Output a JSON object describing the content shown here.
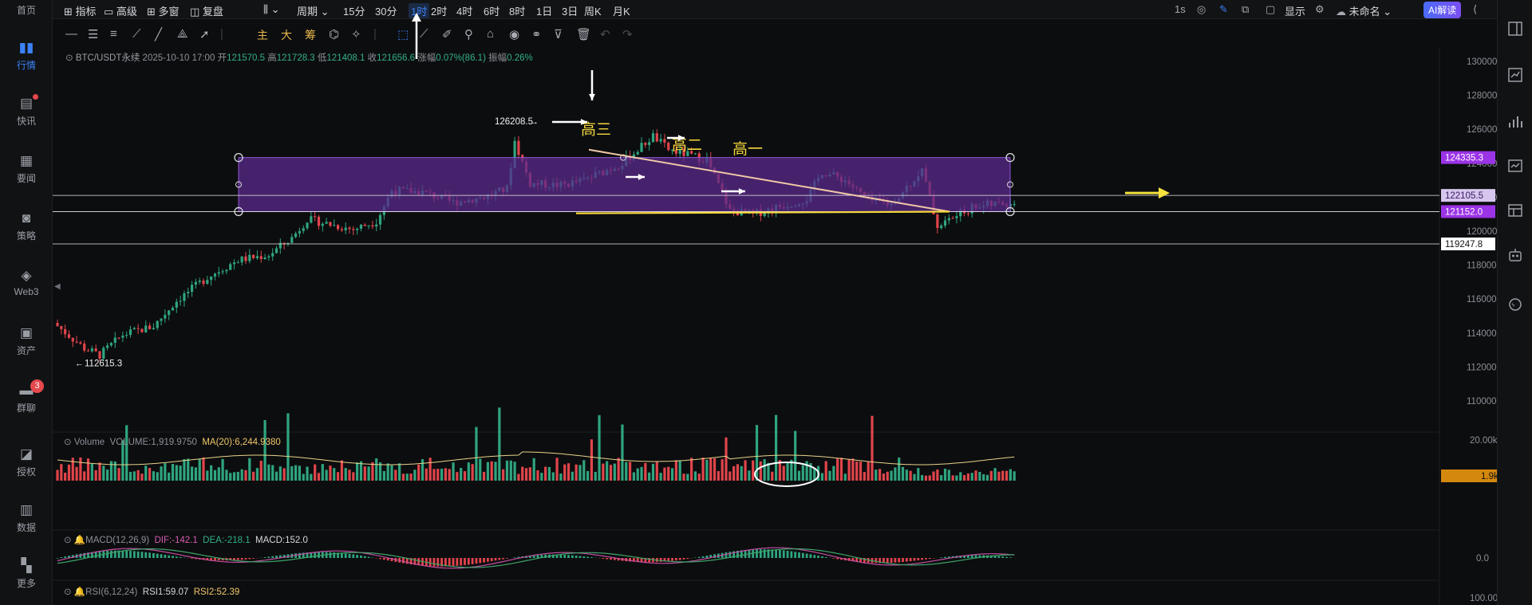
{
  "leftnav": [
    {
      "label": "首页",
      "icon": "home-icon"
    },
    {
      "label": "行情",
      "icon": "chart-bars-icon",
      "active": true
    },
    {
      "label": "快讯",
      "icon": "news-icon",
      "dot": true
    },
    {
      "label": "要闻",
      "icon": "document-icon"
    },
    {
      "label": "策略",
      "icon": "robot-icon"
    },
    {
      "label": "Web3",
      "icon": "web3-icon"
    },
    {
      "label": "资产",
      "icon": "wallet-icon"
    },
    {
      "label": "群聊",
      "icon": "chat-icon",
      "badge": "3"
    },
    {
      "label": "授权",
      "icon": "key-icon"
    },
    {
      "label": "数据",
      "icon": "data-icon"
    },
    {
      "label": "更多",
      "icon": "grid-icon"
    }
  ],
  "topbar": {
    "indicator": "指标",
    "advanced": "高级",
    "multi_window": "多窗",
    "replay": "复盘",
    "period": "周期",
    "intervals": [
      "15分",
      "30分",
      "1时",
      "2时",
      "4时",
      "6时",
      "8时",
      "1日",
      "3日",
      "周K",
      "月K"
    ],
    "active_interval": "1时",
    "refresh": "1s",
    "display": "显示",
    "layout_name": "未命名",
    "ai_button": "AI解读"
  },
  "drawbar": {
    "main": "主",
    "big": "大",
    "chips": "筹"
  },
  "info": {
    "symbol": "BTC/USDT永续",
    "datetime": "2025-10-10 17:00",
    "open_label": "开",
    "open": "121570.5",
    "high_label": "高",
    "high": "121728.3",
    "low_label": "低",
    "low": "121408.1",
    "close_label": "收",
    "close": "121656.6",
    "change_label": "涨幅",
    "change": "0.07%(86.1)",
    "amp_label": "振幅",
    "amp": "0.26%"
  },
  "price_axis": [
    "130000.0",
    "128000.0",
    "126000.0",
    "124000.0",
    "122000.0",
    "120000.0",
    "118000.0",
    "116000.0",
    "114000.0",
    "112000.0",
    "110000.0"
  ],
  "price_tags": {
    "top": "124335.3",
    "current": "122105.5",
    "bottom": "121152.0",
    "support": "119247.8"
  },
  "annotations": {
    "high_price": "126208.5",
    "low_price": "112615.3",
    "gao_san": "高三",
    "gao_er": "高二",
    "gao_yi": "高一"
  },
  "volume": {
    "title": "Volume",
    "volume_label": "VOLUME:1,919.9750",
    "ma_label": "MA(20):6,244.9380",
    "axis": "20.00k",
    "tag": "1.9k"
  },
  "macd": {
    "title": "MACD(12,26,9)",
    "dif": "DIF:-142.1",
    "dea": "DEA:-218.1",
    "macd": "MACD:152.0",
    "axis": "0.0"
  },
  "rsi": {
    "title": "RSI(6,12,24)",
    "rsi1": "RSI1:59.07",
    "rsi2": "RSI2:52.39",
    "axis": "100.00"
  },
  "colors": {
    "up": "#2fa57f",
    "down": "#e0454b",
    "accent": "#3b82f6",
    "box": "#5a2a8c",
    "box_tag": "#9b33e6",
    "volume_tag": "#d4880e",
    "annotation": "#f5d63d"
  }
}
